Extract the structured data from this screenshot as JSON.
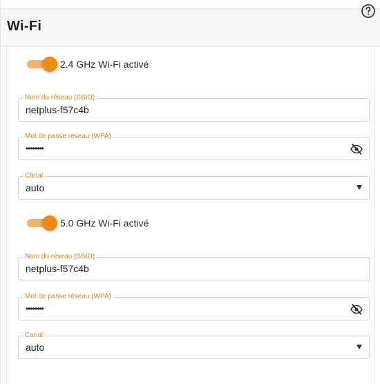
{
  "header": {
    "title": "Wi-Fi",
    "help_icon": "help-circle-icon"
  },
  "bands": [
    {
      "toggle_label": "2.4 GHz Wi-Fi activé",
      "enabled": true,
      "ssid": {
        "label": "Nom du réseau (SSID)",
        "value": "netplus-f57c4b"
      },
      "password": {
        "label": "Mot de passe réseau (WPA)",
        "value": "••••••••",
        "icon": "eye-off-icon"
      },
      "channel": {
        "label": "Canal",
        "value": "auto"
      }
    },
    {
      "toggle_label": "5.0 GHz Wi-Fi activé",
      "enabled": true,
      "ssid": {
        "label": "Nom du réseau (SSID)",
        "value": "netplus-f57c4b"
      },
      "password": {
        "label": "Mot de passe réseau (WPA)",
        "value": "••••••••",
        "icon": "eye-off-icon"
      },
      "channel": {
        "label": "Canal",
        "value": "auto"
      }
    }
  ],
  "colors": {
    "accent": "#ee8a10",
    "accent_light": "#f0b070",
    "header_bg": "#f6f6f6"
  }
}
